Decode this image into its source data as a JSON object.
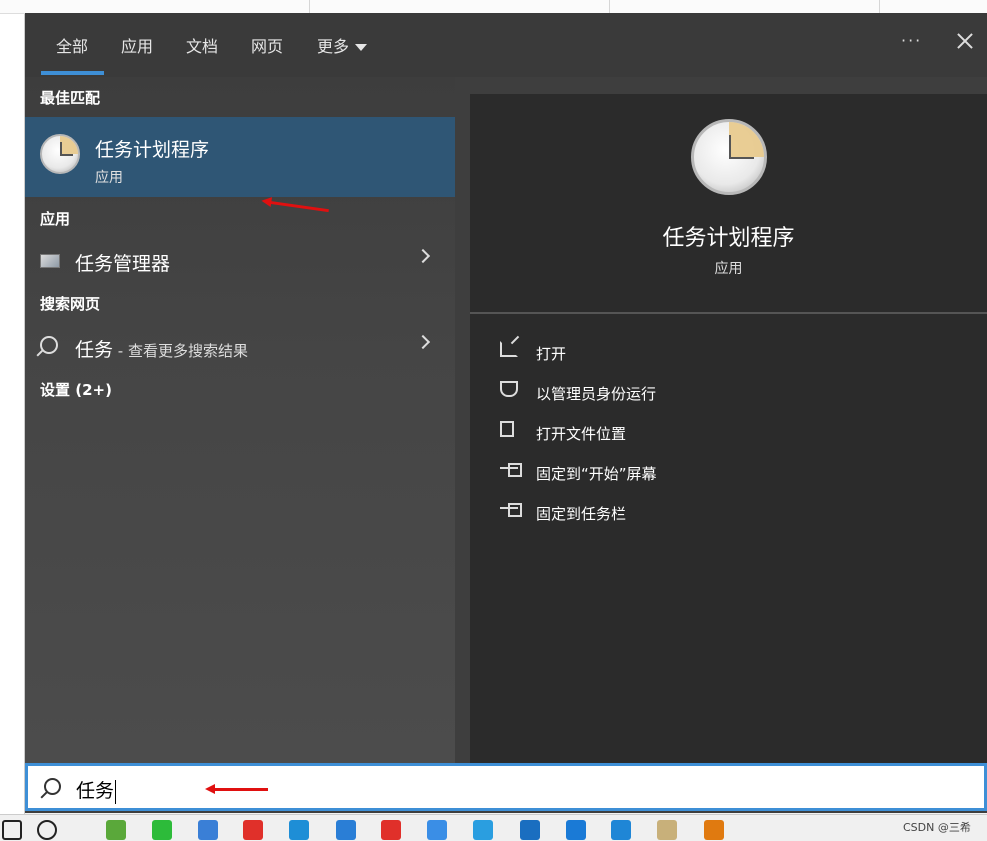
{
  "tabs": [
    {
      "label": "全部"
    },
    {
      "label": "应用"
    },
    {
      "label": "文档"
    },
    {
      "label": "网页"
    },
    {
      "label": "更多"
    }
  ],
  "more_menu": "···",
  "sections": {
    "best_match": "最佳匹配",
    "apps": "应用",
    "web": "搜索网页",
    "settings": "设置 (2+)"
  },
  "best_match": {
    "name": "任务计划程序",
    "type": "应用"
  },
  "apps": [
    {
      "label": "任务管理器"
    }
  ],
  "web": {
    "query": "任务",
    "hint": " - 查看更多搜索结果"
  },
  "detail": {
    "title": "任务计划程序",
    "type": "应用",
    "actions": [
      {
        "label": "打开",
        "icon": "open-icon"
      },
      {
        "label": "以管理员身份运行",
        "icon": "shield-icon"
      },
      {
        "label": "打开文件位置",
        "icon": "file-icon"
      },
      {
        "label": "固定到“开始”屏幕",
        "icon": "pin-icon"
      },
      {
        "label": "固定到任务栏",
        "icon": "pin-icon"
      }
    ]
  },
  "search": {
    "value": "任务"
  },
  "taskbar": {
    "watermark": "CSDN @三希",
    "apps": [
      {
        "name": "start-icon",
        "color": "#222222"
      },
      {
        "name": "search-icon",
        "color": "#222222"
      },
      {
        "name": "browser-icon",
        "color": "#5aa83a"
      },
      {
        "name": "wechat-icon",
        "color": "#2dbb3a"
      },
      {
        "name": "app-icon",
        "color": "#3a7fd6"
      },
      {
        "name": "wps-icon",
        "color": "#e0302a"
      },
      {
        "name": "edge-icon",
        "color": "#1e8ed6"
      },
      {
        "name": "app-icon",
        "color": "#2a7ed6"
      },
      {
        "name": "wps-icon",
        "color": "#e0302a"
      },
      {
        "name": "app-icon",
        "color": "#3a8ee6"
      },
      {
        "name": "app-icon",
        "color": "#2a9ee0"
      },
      {
        "name": "app-icon",
        "color": "#1a6ec0"
      },
      {
        "name": "app-icon",
        "color": "#1a7ad6"
      },
      {
        "name": "vscode-icon",
        "color": "#1f86d6"
      },
      {
        "name": "clock-icon",
        "color": "#c8b07a"
      },
      {
        "name": "search-app-icon",
        "color": "#e07a10"
      }
    ]
  },
  "colors": {
    "accent": "#3e8fd6",
    "selected": "#2f5675"
  }
}
